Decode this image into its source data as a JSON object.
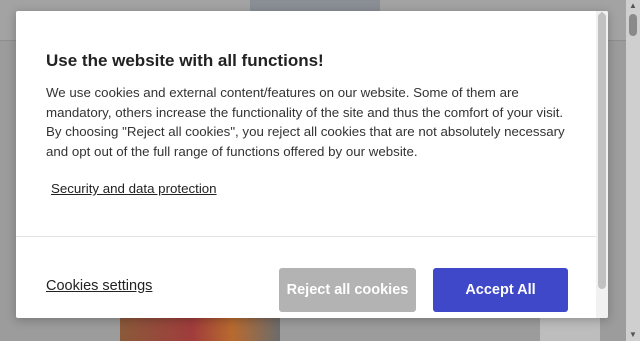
{
  "dialog": {
    "title": "Use the website with all functions!",
    "description": "We use cookies and external content/features on our website. Some of them are mandatory, others increase the functionality of the site and thus the comfort of your visit. By choosing \"Reject all cookies\", you reject all cookies that are not absolutely necessary and opt out of the full range of functions offered by our website.",
    "security_link": "Security and data protection",
    "cookies_settings": "Cookies settings",
    "reject_button": "Reject all cookies",
    "accept_button": "Accept All"
  },
  "colors": {
    "accept": "#3f48c8",
    "reject": "#b3b3b3",
    "overlay": "#9c9c9c"
  },
  "icons": {
    "scroll_up": "scroll-up-arrow-icon",
    "scroll_down": "scroll-down-arrow-icon"
  }
}
